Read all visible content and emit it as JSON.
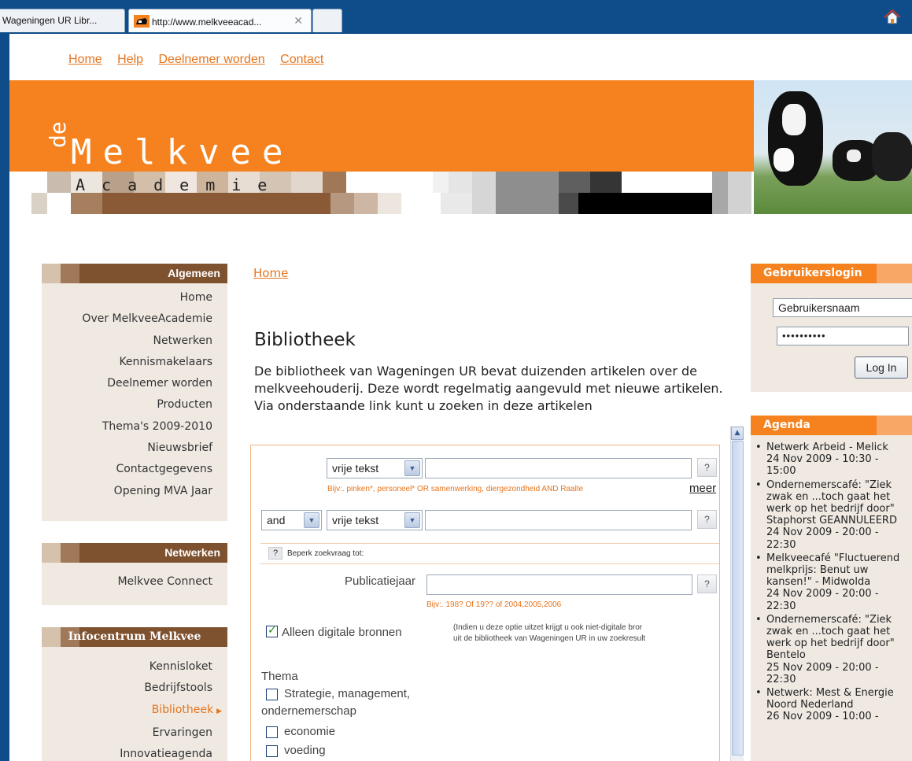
{
  "browser": {
    "tabs": [
      {
        "label": "Wageningen UR Libr..."
      },
      {
        "label": "http://www.melkveeacad..."
      },
      {
        "label": ""
      }
    ],
    "close_glyph": "✕"
  },
  "topnav": [
    "Home",
    "Help",
    "Deelnemer worden",
    "Contact"
  ],
  "logo": {
    "de": "de",
    "melkvee": "Melkvee",
    "academie": "Academie"
  },
  "sidebar": {
    "algemeen": {
      "title": "Algemeen",
      "items": [
        "Home",
        "Over MelkveeAcademie",
        "Netwerken",
        "Kennismakelaars",
        "Deelnemer worden",
        "Producten",
        "Thema's 2009-2010",
        "Nieuwsbrief",
        "Contactgegevens",
        "Opening MVA Jaar"
      ]
    },
    "netwerken": {
      "title": "Netwerken",
      "items": [
        "Melkvee Connect"
      ]
    },
    "infocentrum": {
      "title": "Infocentrum Melkvee",
      "items": [
        "Kennisloket",
        "Bedrijfstools",
        "Bibliotheek",
        "Ervaringen",
        "Innovatieagenda"
      ],
      "active": "Bibliotheek"
    }
  },
  "main": {
    "breadcrumb": "Home",
    "title": "Bibliotheek",
    "intro": "De bibliotheek van Wageningen UR bevat duizenden artikelen over de melkveehouderij. Deze wordt regelmatig aangevuld met nieuwe artikelen. Via onderstaande link kunt u zoeken in deze artikelen"
  },
  "search": {
    "field1_type": "vrije tekst",
    "field1_value": "",
    "hint1": "Bijv:. pinken*, personeel* OR samenwerking, diergezondheid AND Raalte",
    "meer": "meer",
    "operator": "and",
    "field2_type": "vrije tekst",
    "field2_value": "",
    "help_glyph": "?",
    "beperk": "Beperk zoekvraag tot:",
    "publicatiejaar_label": "Publicatiejaar",
    "publicatiejaar_value": "",
    "hint2": "Bijv:. 198? Of 19?? of 2004,2005,2006",
    "digital_label": "Alleen digitale bronnen",
    "digital_checked": true,
    "digital_note_1": "(Indien u deze optie uitzet krijgt u ook niet-digitale bror",
    "digital_note_2": "uit de bibliotheek van Wageningen UR in uw zoekresult",
    "thema_label": "Thema",
    "thema_items": [
      "Strategie, management,",
      "ondernemerschap",
      "economie",
      "voeding"
    ]
  },
  "login": {
    "title": "Gebruikerslogin",
    "username_value": "Gebruikersnaam",
    "password_mask": "••••••••••",
    "button": "Log In"
  },
  "agenda": {
    "title": "Agenda",
    "items": [
      [
        "Netwerk Arbeid - Melick",
        "24 Nov 2009 - 10:30 -",
        "15:00"
      ],
      [
        "Ondernemerscafé: \"Ziek",
        "zwak en ...toch gaat het",
        "werk op het bedrijf door\"",
        "Staphorst GEANNULEERD",
        "24 Nov 2009 - 20:00 -",
        "22:30"
      ],
      [
        "Melkveecafé \"Fluctuerend",
        "melkprijs: Benut uw",
        "kansen!\" - Midwolda",
        "24 Nov 2009 - 20:00 -",
        "22:30"
      ],
      [
        "Ondernemerscafé: \"Ziek",
        "zwak en ...toch gaat het",
        "werk op het bedrijf door\"",
        "Bentelo",
        "25 Nov 2009 - 20:00 -",
        "22:30"
      ],
      [
        "Netwerk: Mest & Energie",
        "Noord Nederland",
        "26 Nov 2009 - 10:00 -"
      ]
    ]
  },
  "colors": {
    "accent": "#f6821f",
    "link": "#e5741d",
    "chrome": "#0e4d89"
  }
}
